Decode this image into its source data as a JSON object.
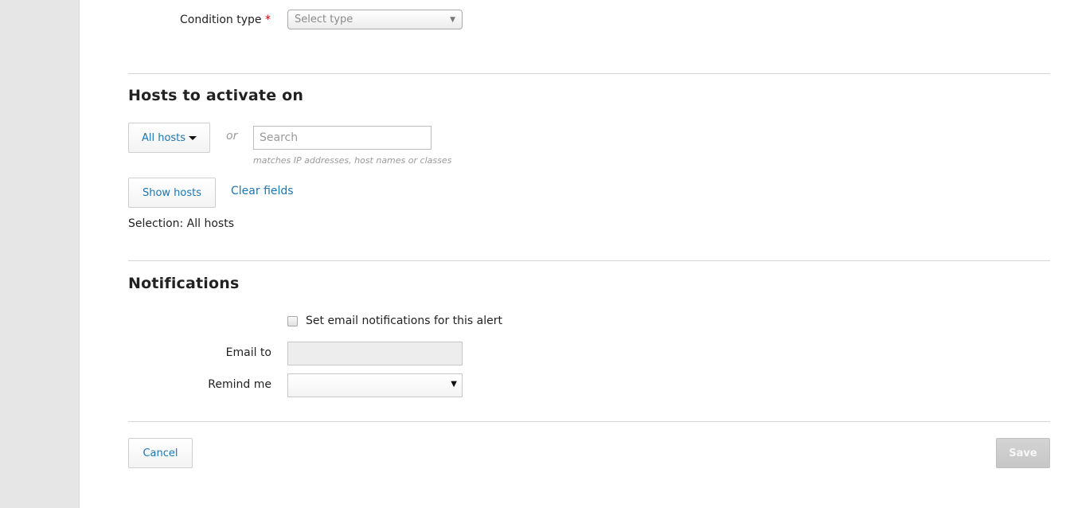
{
  "condition": {
    "label": "Condition type",
    "required_mark": "*",
    "select_placeholder": "Select type",
    "select_arrow": "▼"
  },
  "hosts": {
    "title": "Hosts to activate on",
    "all_hosts_label": "All hosts",
    "or_label": "or",
    "search_placeholder": "Search",
    "search_value": "",
    "hint": "matches IP addresses, host names or classes",
    "show_hosts_label": "Show hosts",
    "clear_fields_label": "Clear fields",
    "selection_text": "Selection: All hosts"
  },
  "notifications": {
    "title": "Notifications",
    "email_checkbox_label": "Set email notifications for this alert",
    "email_checkbox_checked": false,
    "email_to_label": "Email to",
    "email_to_value": "",
    "remind_me_label": "Remind me",
    "remind_me_value": "",
    "remind_arrow": "▼"
  },
  "footer": {
    "cancel_label": "Cancel",
    "save_label": "Save"
  },
  "colors": {
    "link": "#1a77b0",
    "required": "#cc0000",
    "sidebar_bg": "#e6e6e6",
    "save_disabled_bg": "#c9c9c9"
  }
}
